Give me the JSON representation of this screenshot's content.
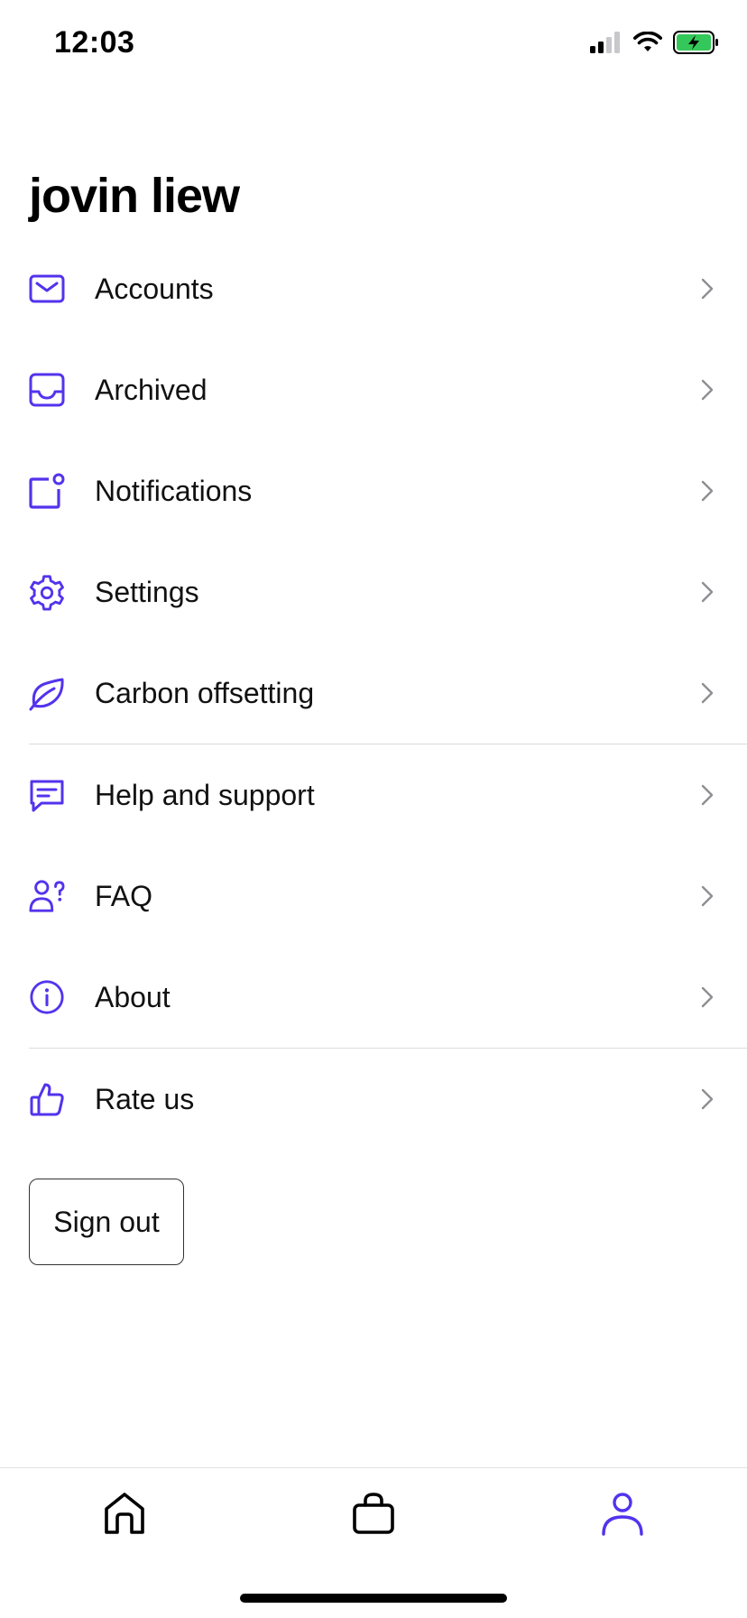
{
  "status_bar": {
    "time": "12:03"
  },
  "profile": {
    "name": "jovin liew"
  },
  "menu": {
    "items": [
      {
        "label": "Accounts",
        "icon": "mail-icon"
      },
      {
        "label": "Archived",
        "icon": "inbox-icon"
      },
      {
        "label": "Notifications",
        "icon": "notification-icon"
      },
      {
        "label": "Settings",
        "icon": "gear-icon"
      },
      {
        "label": "Carbon offsetting",
        "icon": "leaf-icon"
      },
      {
        "label": "Help and support",
        "icon": "chat-icon"
      },
      {
        "label": "FAQ",
        "icon": "user-question-icon"
      },
      {
        "label": "About",
        "icon": "info-icon"
      },
      {
        "label": "Rate us",
        "icon": "thumbs-up-icon"
      }
    ]
  },
  "actions": {
    "sign_out": "Sign out"
  },
  "tab_bar": {
    "tabs": [
      {
        "name": "home",
        "icon": "home-icon",
        "active": false
      },
      {
        "name": "shop",
        "icon": "shopping-bag-icon",
        "active": false
      },
      {
        "name": "profile",
        "icon": "user-icon",
        "active": true
      }
    ]
  },
  "colors": {
    "accent": "#5333ED",
    "chevron": "#8e8e93",
    "divider": "#dcdcdc",
    "battery": "#34c759"
  }
}
